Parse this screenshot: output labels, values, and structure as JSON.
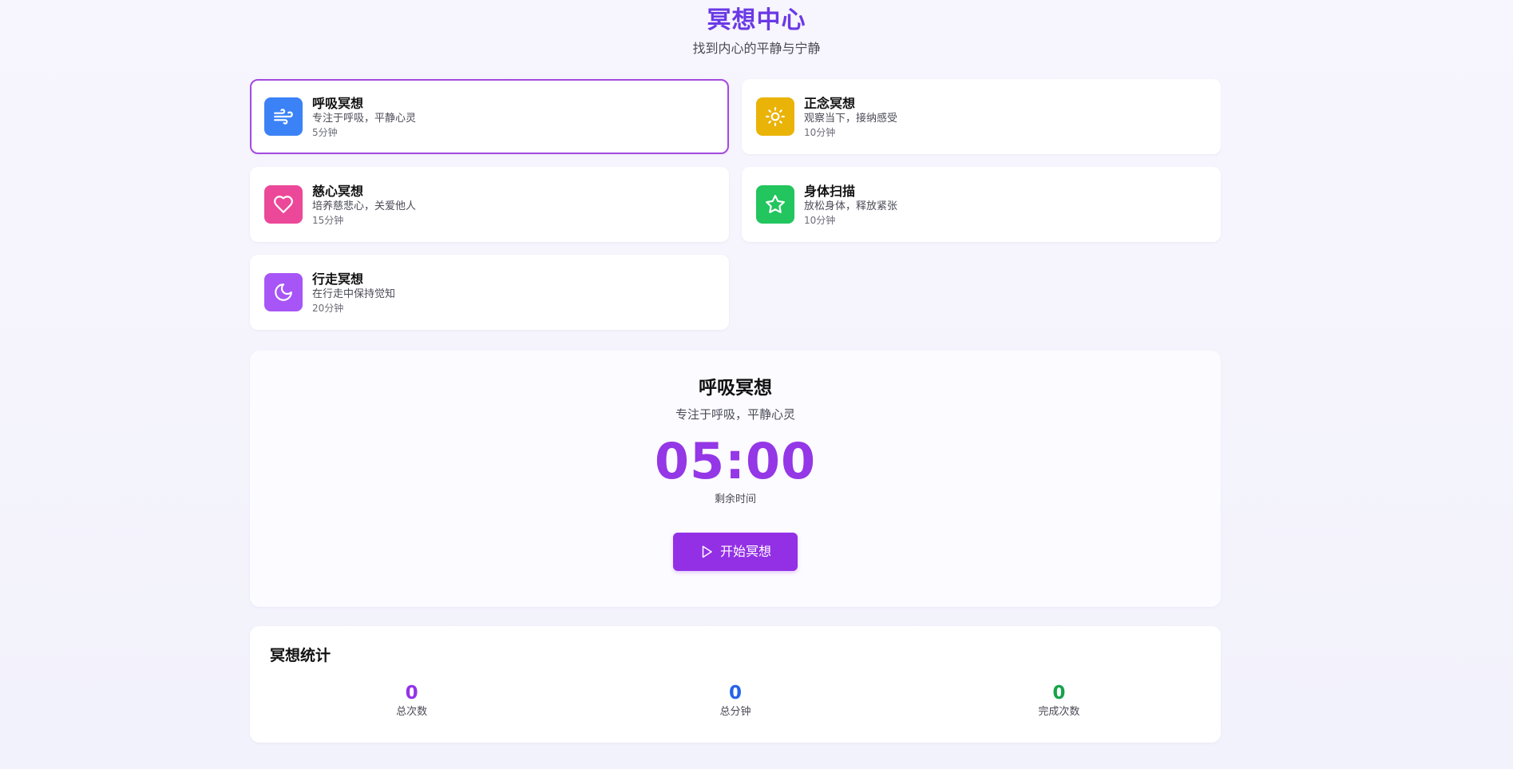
{
  "header": {
    "title": "冥想中心",
    "subtitle": "找到内心的平静与宁静"
  },
  "meditations": [
    {
      "title": "呼吸冥想",
      "description": "专注于呼吸，平静心灵",
      "duration": "5分钟",
      "icon": "wind-icon",
      "color": "#3b82f6",
      "selected": true
    },
    {
      "title": "正念冥想",
      "description": "观察当下，接纳感受",
      "duration": "10分钟",
      "icon": "sun-icon",
      "color": "#eab308",
      "selected": false
    },
    {
      "title": "慈心冥想",
      "description": "培养慈悲心，关爱他人",
      "duration": "15分钟",
      "icon": "heart-icon",
      "color": "#ec4899",
      "selected": false
    },
    {
      "title": "身体扫描",
      "description": "放松身体，释放紧张",
      "duration": "10分钟",
      "icon": "star-icon",
      "color": "#22c55e",
      "selected": false
    },
    {
      "title": "行走冥想",
      "description": "在行走中保持觉知",
      "duration": "20分钟",
      "icon": "moon-icon",
      "color": "#a855f7",
      "selected": false
    }
  ],
  "timer": {
    "title": "呼吸冥想",
    "description": "专注于呼吸，平静心灵",
    "time": "05:00",
    "caption": "剩余时间",
    "start_label": "开始冥想",
    "start_icon": "play-icon",
    "accent": "#9437e6"
  },
  "stats": {
    "title": "冥想统计",
    "items": [
      {
        "value": "0",
        "label": "总次数",
        "color": "#9333ea"
      },
      {
        "value": "0",
        "label": "总分钟",
        "color": "#2563eb"
      },
      {
        "value": "0",
        "label": "完成次数",
        "color": "#16a34a"
      }
    ]
  }
}
